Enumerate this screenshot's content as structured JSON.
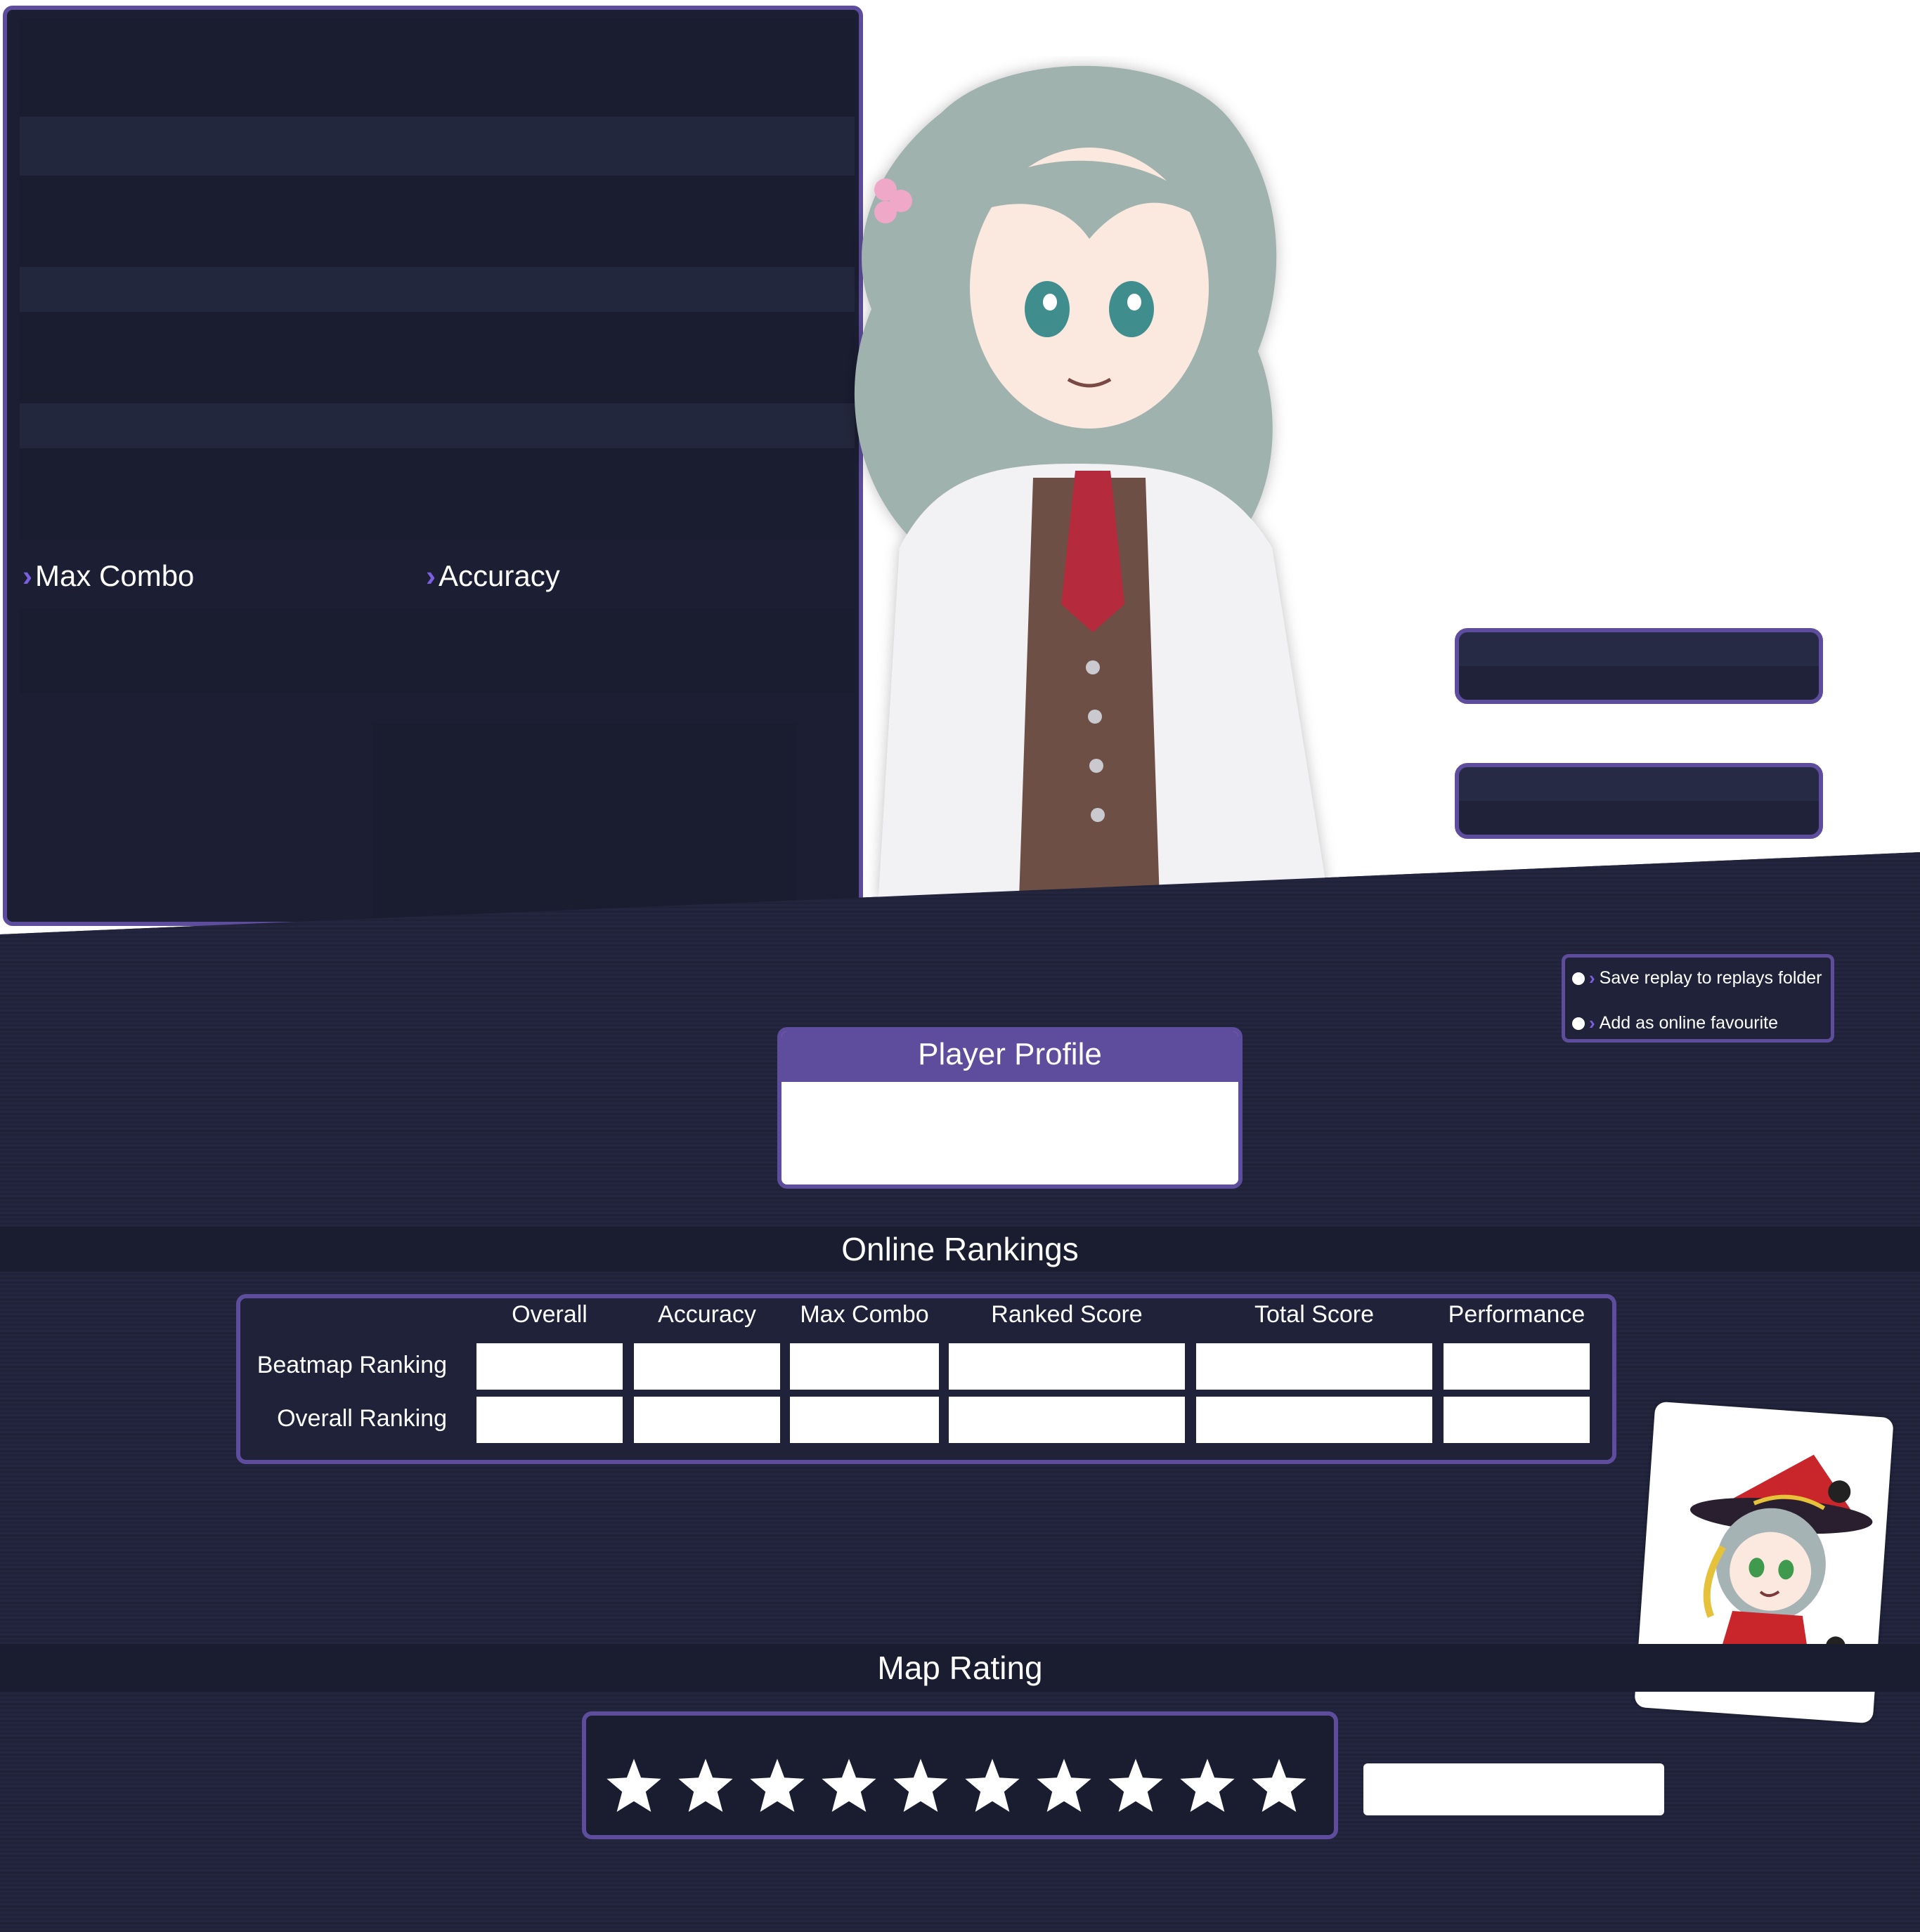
{
  "stats": {
    "max_combo_label": "Max Combo",
    "accuracy_label": "Accuracy"
  },
  "options": {
    "save_replay": "Save replay to replays folder",
    "add_favourite": "Add as online favourite"
  },
  "profile": {
    "title": "Player Profile"
  },
  "rankings": {
    "title": "Online Rankings",
    "columns": [
      "Overall",
      "Accuracy",
      "Max Combo",
      "Ranked Score",
      "Total Score",
      "Performance"
    ],
    "rows": [
      "Beatmap Ranking",
      "Overall Ranking"
    ]
  },
  "rating": {
    "title": "Map Rating",
    "star_count": 10
  },
  "colors": {
    "accent": "#5e4d9c",
    "chevron": "#7b5fe0",
    "panel_bg": "#1f2238"
  }
}
